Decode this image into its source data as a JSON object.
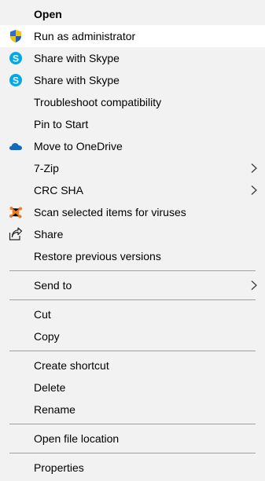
{
  "menu": {
    "open": "Open",
    "run_as_admin": "Run as administrator",
    "share_skype_1": "Share with Skype",
    "share_skype_2": "Share with Skype",
    "troubleshoot": "Troubleshoot compatibility",
    "pin_to_start": "Pin to Start",
    "move_to_onedrive": "Move to OneDrive",
    "seven_zip": "7-Zip",
    "crc_sha": "CRC SHA",
    "scan_viruses": "Scan selected items for viruses",
    "share": "Share",
    "restore_previous": "Restore previous versions",
    "send_to": "Send to",
    "cut": "Cut",
    "copy": "Copy",
    "create_shortcut": "Create shortcut",
    "delete": "Delete",
    "rename": "Rename",
    "open_file_location": "Open file location",
    "properties": "Properties"
  },
  "icons": {
    "run_as_admin": "uac-shield-icon",
    "skype": "skype-icon",
    "onedrive": "onedrive-cloud-icon",
    "avast": "avast-icon",
    "share": "share-icon",
    "submenu": "chevron-right-icon"
  },
  "colors": {
    "menu_background": "#f2f2f2",
    "hover_background": "#ffffff",
    "separator": "#a0a0a0",
    "skype_blue": "#00a8e8",
    "onedrive_blue": "#0f6cbd",
    "avast_orange": "#f47a20"
  },
  "state": {
    "highlighted_item": "Run as administrator"
  }
}
